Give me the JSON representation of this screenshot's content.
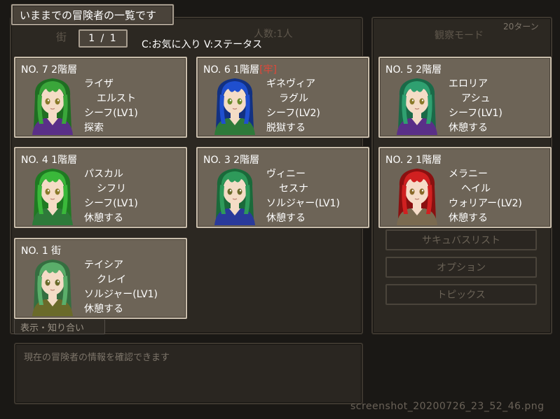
{
  "title": "いままでの冒険者の一覧です",
  "page_indicator": "1 / 1",
  "hint": "C:お気に入り V:ステータス",
  "background": {
    "town_label": "街",
    "count_label": "人数:1人",
    "mode_label": "観察モード",
    "turn_label": "20ターン",
    "display_tab": "表示・知り合い",
    "status_message": "現在の冒険者の情報を確認できます",
    "menu": [
      "サキュバスリスト",
      "オプション",
      "トピックス"
    ]
  },
  "adventurers": [
    {
      "header": "NO. 7  2階層",
      "jail": "",
      "name1": "ライザ",
      "name2": "エルスト",
      "job": "シーフ(LV1)",
      "action": "探索",
      "hair": "#3aa63a",
      "hair_dark": "#1f6e22",
      "eyes": "#8a7a2a",
      "outfit": "#5a2f88",
      "skin": "#f4dcc6"
    },
    {
      "header": "NO. 6  1階層",
      "jail": "[牢]",
      "name1": "ギネヴィア",
      "name2": "ラグル",
      "job": "シーフ(LV2)",
      "action": "脱獄する",
      "hair": "#1f4fcf",
      "hair_dark": "#123182",
      "eyes": "#6a8a2a",
      "outfit": "#2e7a3a",
      "skin": "#f4dcc6"
    },
    {
      "header": "NO. 5  2階層",
      "jail": "",
      "name1": "エロリア",
      "name2": "アシュ",
      "job": "シーフ(LV1)",
      "action": "休憩する",
      "hair": "#2fa070",
      "hair_dark": "#1a6a48",
      "eyes": "#8a7a2a",
      "outfit": "#5a2f88",
      "skin": "#f4dcc6"
    },
    {
      "header": "NO. 4  1階層",
      "jail": "",
      "name1": "パスカル",
      "name2": "シフリ",
      "job": "シーフ(LV1)",
      "action": "休憩する",
      "hair": "#3ab83a",
      "hair_dark": "#1f7a22",
      "eyes": "#8a7a2a",
      "outfit": "#2e7a3a",
      "skin": "#f4dcc6"
    },
    {
      "header": "NO. 3  2階層",
      "jail": "",
      "name1": "ヴィニー",
      "name2": "セスナ",
      "job": "ソルジャー(LV1)",
      "action": "休憩する",
      "hair": "#2e9a5a",
      "hair_dark": "#1a6a3a",
      "eyes": "#6a6a2a",
      "outfit": "#2a3a9a",
      "skin": "#f4dcc6"
    },
    {
      "header": "NO. 2  1階層",
      "jail": "",
      "name1": "メラニー",
      "name2": "ヘイル",
      "job": "ウォリアー(LV2)",
      "action": "休憩する",
      "hair": "#d02020",
      "hair_dark": "#8a1010",
      "eyes": "#8a6a2a",
      "outfit": "#7a6a50",
      "skin": "#f6dcc8"
    },
    {
      "header": "NO. 1  街",
      "jail": "",
      "name1": "テイシア",
      "name2": "クレイ",
      "job": "ソルジャー(LV1)",
      "action": "休憩する",
      "hair": "#5aae6a",
      "hair_dark": "#356e40",
      "eyes": "#6a6a2a",
      "outfit": "#6a6a2a",
      "skin": "#f4dcc6"
    }
  ],
  "watermark": "screenshot_20200726_23_52_46.png"
}
